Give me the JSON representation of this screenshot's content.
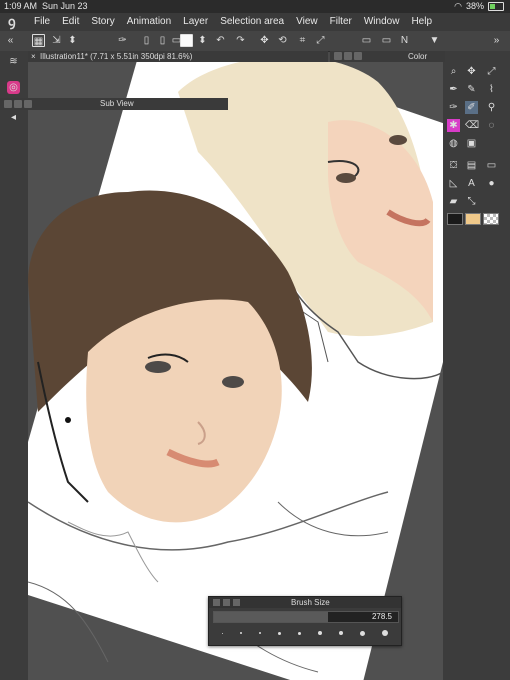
{
  "status": {
    "time": "1:09 AM",
    "date": "Sun Jun 23",
    "battery": "38%"
  },
  "app": {
    "logo": "ꝯ"
  },
  "menu": [
    "File",
    "Edit",
    "Story",
    "Animation",
    "Layer",
    "Selection area",
    "View",
    "Filter",
    "Window",
    "Help"
  ],
  "document": {
    "tab_title": "Illustration11* (7.71 x 5.51in 350dpi 81.6%)"
  },
  "panels": {
    "color_wheel_title": "Color Wheel",
    "sub_view_title": "Sub View"
  },
  "brush_size": {
    "title": "Brush Size",
    "value": "278.5",
    "fraction": 0.62
  },
  "colors": {
    "main": "#1a1a1a",
    "sub": "#f0c98a",
    "accent": "#d83cc8"
  },
  "icons": {
    "toolbar": [
      "grid-icon",
      "layer-move-icon",
      "spin-icon",
      "swirl-icon",
      "pen-tool-icon",
      "new-file-icon",
      "open-file-icon",
      "save-icon",
      "checkbox-icon",
      "stepper-icon",
      "undo-icon",
      "redo-icon",
      "transform-icon",
      "rotate-icon",
      "crop-icon",
      "lasso-icon",
      "ruler-icon",
      "dropdown-icon"
    ],
    "left": [
      "layers-icon",
      "instagram-icon"
    ],
    "right": [
      "zoom-icon",
      "move-icon",
      "eyedropper-icon",
      "pen-icon",
      "pencil-icon",
      "brush-icon",
      "airbrush-icon",
      "decoration-icon",
      "eraser-icon",
      "blend-icon",
      "fill-icon",
      "gradient-icon",
      "rectangle-icon",
      "line-icon",
      "text-icon",
      "balloon-icon",
      "ruler-icon",
      "correct-line-icon"
    ]
  }
}
